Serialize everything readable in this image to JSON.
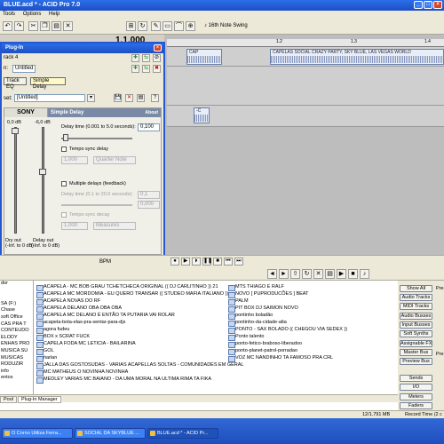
{
  "app": {
    "title": "BLUE.acd * - ACID Pro 7.0",
    "menu": [
      "Tools",
      "Options",
      "Help"
    ],
    "swing_label": "16th Note Swing",
    "time_display": "1.1.000"
  },
  "ruler": {
    "ticks": [
      "1.2",
      "1.3",
      "1.4"
    ]
  },
  "clips": {
    "clip1": "CAP",
    "clip2": "CAPELAS SOCIAL CRAZY PARTY, SKY BLUE, LAS VEGAS WORLD",
    "clip3": "-C"
  },
  "plugin": {
    "title": "Plug-In",
    "track": "rack 4",
    "chain_label": "n:",
    "chain_value": "Untitled",
    "chain_track_eq": "Track EQ",
    "chain_simple_delay": "Simple Delay",
    "preset_label": "set:",
    "preset_value": "[Untitled]",
    "brand": "SONY",
    "fx_name": "Simple Delay",
    "about": "About",
    "help": "?",
    "dry_db": "0,0 dB",
    "wet_db": "-6,0 dB",
    "delay_label": "Delay time (0.001 to 5.0 seconds):",
    "delay_value": "0,100",
    "tempo_sync_label": "Tempo sync delay",
    "tempo_value": "1,000",
    "tempo_unit": "Quarter Note",
    "multiple_label": "Multiple delays (feedback)",
    "multi_delay_label": "Delay time (0.1 to 20.0 seconds):",
    "multi_delay_value": "0,1",
    "multi_value2": "0,000",
    "tempo_sync_decay_label": "Tempo sync decay",
    "decay_value": "1,000",
    "decay_unit": "Measures",
    "dry_out_label": "Dry out",
    "dry_out_range": "(-Inf. to 0 dB)",
    "delay_out_label": "Delay out",
    "delay_out_range": "(-Inf. to 0 dB)"
  },
  "transport": {
    "bpm_label": "BPM"
  },
  "explorer": {
    "tree": [
      "dor",
      "",
      "",
      "SA (F:)",
      "Chase",
      "soft Office",
      "CAS PRA T",
      "CONTEUDO",
      "ELODY",
      "ENHAS PRO",
      "MUSICA SU",
      "MUSICAS",
      "RODUZIR",
      "info",
      "entos"
    ],
    "files_col1": [
      "ACAPELA - MC BOB GRAU TCHETCHECA ORIGINAL (( DJ CARLITINHO )) 21",
      "ACAPELA MC MORDOMIA - EU QUERO TRANSAR (( STUDEO MAFIA ITALIANO ))",
      "ACAPELA NOVAS DO RF",
      "ACAPELA DELANO OBA OBA OBA",
      "ACAPELA MC DELANO É ENTÃO TA PUTARIA VAI ROLAR",
      "acapela-bota-elas-pra-sentar-para-djs",
      "agora fudeu",
      "BOX x SCRAT FUCK",
      "CAPELA FODA MC LETICIA - BAILARINA",
      "GOL",
      "harlan",
      "JALLA DAS GOSTOSUDAS - VARIAS  ACAPELLAS SOLTAS - COMUNIDADES EM GERAL",
      "MC MATHEUS O NOVINHA NOVINHA",
      "MEDLEY VARIAS MC BAIANO - DA UMA MORAL NA ULTIMA RIMA TA FIKA"
    ],
    "files_col2": [
      "MTS THIAGO E RALF",
      "NOVO [ PUPRODUCÕES ] BEAT",
      "PALM",
      "PIT BOX DJ SAIMON NOVO",
      "pontinho boladão",
      "pontinho-da-cidade-alta",
      "PONTO - SAX BOLADO (( CHEGOU VIA SEDEX ))",
      "Ponto talento",
      "ponto-fetico-braboso-liberadoo",
      "ponto-planet-patrol-porradao",
      "VOZ MC NANDINHO TA FAMOSO PRA CRL"
    ],
    "buttons": [
      "Show All",
      "Audio Tracks",
      "MIDI Tracks",
      "Audio Busses",
      "Input Busses",
      "Soft Synths",
      "Assignable FX",
      "Master Bus",
      "Preview Bus",
      "Sends",
      "I/O",
      "Meters",
      "Faders"
    ],
    "pre_labels": [
      "Pre",
      "Pre"
    ],
    "tabs": [
      "Pool",
      "Plug-In Manager"
    ]
  },
  "status": {
    "memory": "12/1.791 MB",
    "record_time": "Record Time (2 c"
  },
  "taskbar": [
    "O Corno Utiliza Ferra...",
    "SOCIAL DA SKYBLUE ...",
    "BLUE.acd * - ACID Pr..."
  ]
}
